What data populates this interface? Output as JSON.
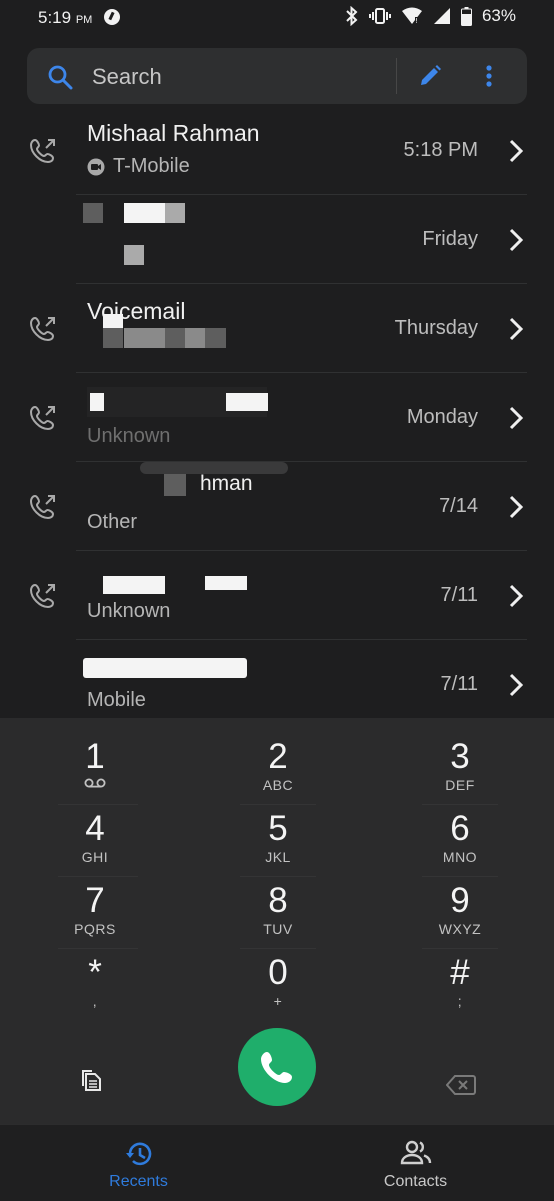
{
  "status": {
    "time": "5:19",
    "ampm": "PM",
    "battery": "63%"
  },
  "search": {
    "placeholder": "Search"
  },
  "calls": [
    {
      "name": "Mishaal Rahman",
      "sub": "T-Mobile",
      "date": "5:18 PM"
    },
    {
      "name": "",
      "sub": "",
      "date": "Friday"
    },
    {
      "name": "Voicemail",
      "sub": "",
      "date": "Thursday"
    },
    {
      "name": "",
      "sub": "Unknown",
      "date": "Monday"
    },
    {
      "name": "hman",
      "sub": "Other",
      "date": "7/14"
    },
    {
      "name": "",
      "sub": "Unknown",
      "date": "7/11"
    },
    {
      "name": "",
      "sub": "Mobile",
      "date": "7/11"
    }
  ],
  "dialpad": {
    "keys": [
      {
        "digit": "1",
        "letters": ""
      },
      {
        "digit": "2",
        "letters": "ABC"
      },
      {
        "digit": "3",
        "letters": "DEF"
      },
      {
        "digit": "4",
        "letters": "GHI"
      },
      {
        "digit": "5",
        "letters": "JKL"
      },
      {
        "digit": "6",
        "letters": "MNO"
      },
      {
        "digit": "7",
        "letters": "PQRS"
      },
      {
        "digit": "8",
        "letters": "TUV"
      },
      {
        "digit": "9",
        "letters": "WXYZ"
      },
      {
        "digit": "*",
        "letters": ","
      },
      {
        "digit": "0",
        "letters": "+"
      },
      {
        "digit": "#",
        "letters": ";"
      }
    ]
  },
  "nav": {
    "recents": "Recents",
    "contacts": "Contacts"
  },
  "colors": {
    "background": "#1e1e1f",
    "accent": "#2f7bdc",
    "call_button": "#1fae6b"
  }
}
